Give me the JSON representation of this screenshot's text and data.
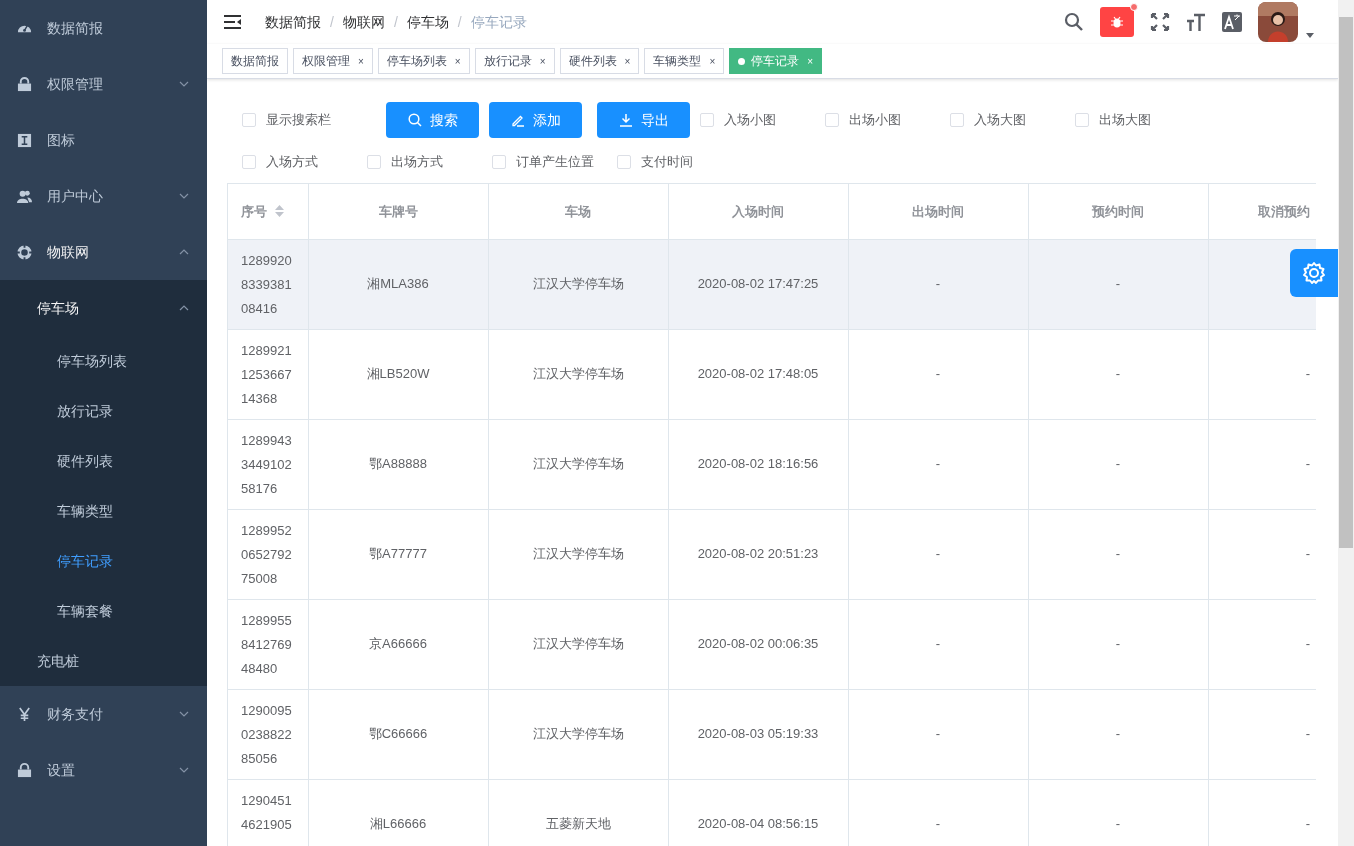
{
  "sidebar": {
    "items": [
      {
        "label": "数据简报"
      },
      {
        "label": "权限管理",
        "expanded": false
      },
      {
        "label": "图标"
      },
      {
        "label": "用户中心",
        "expanded": false
      },
      {
        "label": "物联网",
        "expanded": true,
        "children": [
          {
            "label": "停车场",
            "expanded": true,
            "children": [
              {
                "label": "停车场列表",
                "selected": false
              },
              {
                "label": "放行记录",
                "selected": false
              },
              {
                "label": "硬件列表",
                "selected": false
              },
              {
                "label": "车辆类型",
                "selected": false
              },
              {
                "label": "停车记录",
                "selected": true
              },
              {
                "label": "车辆套餐",
                "selected": false
              }
            ]
          },
          {
            "label": "充电桩"
          }
        ]
      },
      {
        "label": "财务支付",
        "expanded": false
      },
      {
        "label": "设置",
        "expanded": false
      }
    ]
  },
  "breadcrumb_separator": "/",
  "breadcrumb": [
    {
      "label": "数据简报",
      "current": false
    },
    {
      "label": "物联网",
      "current": false
    },
    {
      "label": "停车场",
      "current": false
    },
    {
      "label": "停车记录",
      "current": true
    }
  ],
  "header_actions": {
    "bug_alert": true
  },
  "tabs": [
    {
      "label": "数据简报",
      "selected": false
    },
    {
      "label": "权限管理",
      "selected": false,
      "close": "×"
    },
    {
      "label": "停车场列表",
      "selected": false,
      "close": "×"
    },
    {
      "label": "放行记录",
      "selected": false,
      "close": "×"
    },
    {
      "label": "硬件列表",
      "selected": false,
      "close": "×"
    },
    {
      "label": "车辆类型",
      "selected": false,
      "close": "×"
    },
    {
      "label": "停车记录",
      "selected": true,
      "close": "×"
    }
  ],
  "toolbar": [
    {
      "kind": "checkbox",
      "label": "显示搜索栏",
      "checked": false
    },
    {
      "kind": "button",
      "label": "搜索"
    },
    {
      "kind": "button",
      "label": "添加"
    },
    {
      "kind": "button",
      "label": "导出"
    },
    {
      "kind": "checkbox",
      "label": "入场小图",
      "checked": false
    },
    {
      "kind": "checkbox",
      "label": "出场小图",
      "checked": false
    },
    {
      "kind": "checkbox",
      "label": "入场大图",
      "checked": false
    },
    {
      "kind": "checkbox",
      "label": "出场大图",
      "checked": false
    },
    {
      "kind": "checkbox",
      "label": "入场方式",
      "checked": false
    },
    {
      "kind": "checkbox",
      "label": "出场方式",
      "checked": false
    },
    {
      "kind": "checkbox",
      "label": "订单产生位置",
      "checked": false
    },
    {
      "kind": "checkbox",
      "label": "支付时间",
      "checked": false
    }
  ],
  "table": {
    "columns": [
      {
        "label": "序号"
      },
      {
        "label": "车牌号"
      },
      {
        "label": "车场"
      },
      {
        "label": "入场时间"
      },
      {
        "label": "出场时间"
      },
      {
        "label": "预约时间"
      },
      {
        "label": "取消预约"
      }
    ],
    "rows": [
      {
        "highlighted": true,
        "cells": [
          "1289920833938108416",
          "湘MLA386",
          "江汉大学停车场",
          "2020-08-02 17:47:25",
          "-",
          "-"
        ]
      },
      {
        "highlighted": false,
        "cells": [
          "1289921125366714368",
          "湘LB520W",
          "江汉大学停车场",
          "2020-08-02 17:48:05",
          "-",
          "-",
          "-"
        ]
      },
      {
        "highlighted": false,
        "cells": [
          "1289943344910258176",
          "鄂A88888",
          "江汉大学停车场",
          "2020-08-02 18:16:56",
          "-",
          "-",
          "-"
        ]
      },
      {
        "highlighted": false,
        "cells": [
          "1289952065279275008",
          "鄂A77777",
          "江汉大学停车场",
          "2020-08-02 20:51:23",
          "-",
          "-",
          "-"
        ]
      },
      {
        "highlighted": false,
        "cells": [
          "1289955841276948480",
          "京A66666",
          "江汉大学停车场",
          "2020-08-02 00:06:35",
          "-",
          "-",
          "-"
        ]
      },
      {
        "highlighted": false,
        "cells": [
          "1290095023882285056",
          "鄂C66666",
          "江汉大学停车场",
          "2020-08-03 05:19:33",
          "-",
          "-",
          "-"
        ]
      },
      {
        "highlighted": false,
        "cells": [
          "12904514621905",
          "湘L66666",
          "五菱新天地",
          "2020-08-04 08:56:15",
          "-",
          "-",
          "-"
        ]
      }
    ]
  }
}
